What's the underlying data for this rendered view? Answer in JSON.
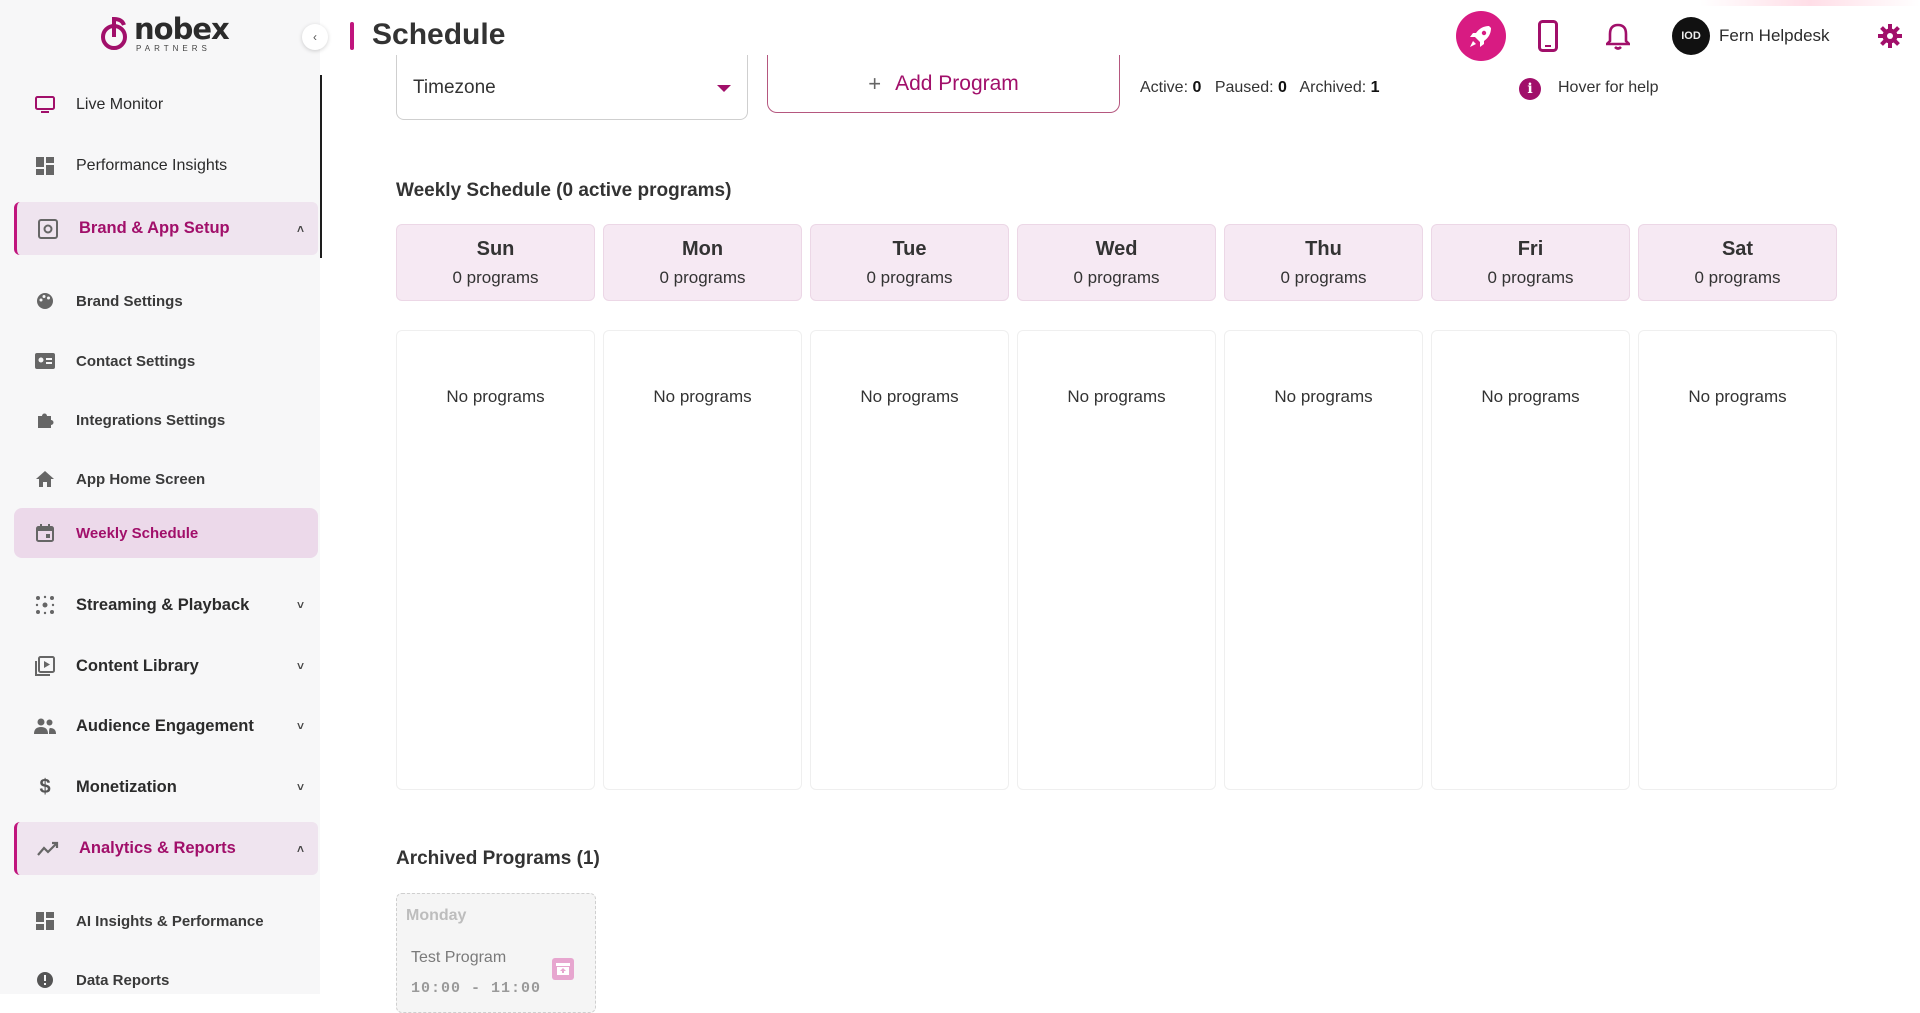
{
  "brand": {
    "name": "nobex",
    "tagline": "PARTNERS",
    "accent": "#c0157d"
  },
  "header": {
    "title": "Schedule",
    "user_name": "Fern Helpdesk",
    "avatar_text": "IOD"
  },
  "sidebar": {
    "top_items": [
      {
        "label": "Live Monitor",
        "icon": "monitor-icon"
      },
      {
        "label": "Performance Insights",
        "icon": "dashboard-icon"
      }
    ],
    "groups": {
      "brand_setup": {
        "label": "Brand & App Setup",
        "items": [
          {
            "label": "Brand Settings",
            "icon": "palette-icon"
          },
          {
            "label": "Contact Settings",
            "icon": "contact-card-icon"
          },
          {
            "label": "Integrations Settings",
            "icon": "puzzle-icon"
          },
          {
            "label": "App Home Screen",
            "icon": "home-icon"
          },
          {
            "label": "Weekly Schedule",
            "icon": "calendar-icon"
          }
        ]
      },
      "streaming": {
        "label": "Streaming & Playback"
      },
      "content": {
        "label": "Content Library"
      },
      "audience": {
        "label": "Audience Engagement"
      },
      "monetization": {
        "label": "Monetization"
      },
      "analytics": {
        "label": "Analytics & Reports",
        "items": [
          {
            "label": "AI Insights & Performance",
            "icon": "dashboard-icon"
          },
          {
            "label": "Data Reports",
            "icon": "report-icon"
          }
        ]
      }
    }
  },
  "toolbar": {
    "timezone_label": "Timezone",
    "add_program_label": "Add Program",
    "active_label": "Active:",
    "active_count": "0",
    "paused_label": "Paused:",
    "paused_count": "0",
    "archived_label": "Archived:",
    "archived_count": "1",
    "help_text": "Hover for help"
  },
  "schedule": {
    "title": "Weekly Schedule (0 active programs)",
    "days": [
      {
        "name": "Sun",
        "count": "0 programs",
        "empty": "No programs"
      },
      {
        "name": "Mon",
        "count": "0 programs",
        "empty": "No programs"
      },
      {
        "name": "Tue",
        "count": "0 programs",
        "empty": "No programs"
      },
      {
        "name": "Wed",
        "count": "0 programs",
        "empty": "No programs"
      },
      {
        "name": "Thu",
        "count": "0 programs",
        "empty": "No programs"
      },
      {
        "name": "Fri",
        "count": "0 programs",
        "empty": "No programs"
      },
      {
        "name": "Sat",
        "count": "0 programs",
        "empty": "No programs"
      }
    ]
  },
  "archived": {
    "title": "Archived Programs (1)",
    "programs": [
      {
        "day": "Monday",
        "name": "Test Program",
        "time": "10:00 - 11:00"
      }
    ]
  }
}
